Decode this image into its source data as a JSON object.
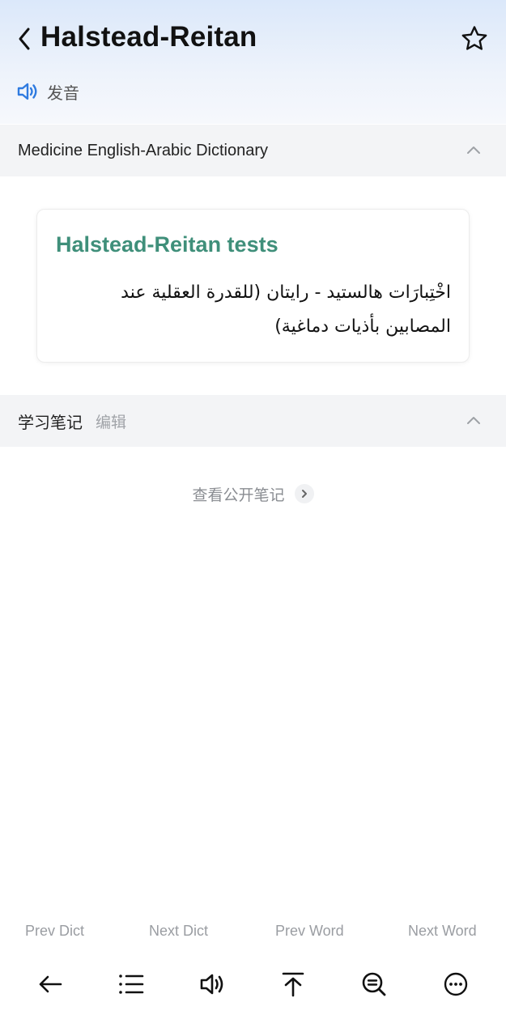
{
  "header": {
    "word": "Halstead-Reitan",
    "pronounce_label": "发音"
  },
  "dictionary": {
    "name": "Medicine English-Arabic Dictionary",
    "entry": {
      "term": "Halstead-Reitan tests",
      "definition": "اخْتِبارَات هالستيد - رايتان (للقدرة العقلية عند المصابين بأذيات دماغية)"
    }
  },
  "notes": {
    "title": "学习笔记",
    "edit_label": "编辑",
    "public_notes_label": "查看公开笔记"
  },
  "bottom_nav": {
    "prev_dict": "Prev Dict",
    "next_dict": "Next Dict",
    "prev_word": "Prev Word",
    "next_word": "Next Word"
  },
  "colors": {
    "term_accent": "#3f8f7a",
    "speaker_blue": "#2f7be0",
    "header_gradient_top": "#dbe8fa"
  },
  "icons": [
    "back-arrow-icon",
    "star-icon",
    "speaker-icon",
    "chevron-up-icon",
    "chevron-right-icon",
    "arrow-left-icon",
    "list-icon",
    "speaker-outline-icon",
    "scroll-top-icon",
    "search-text-icon",
    "more-icon"
  ]
}
